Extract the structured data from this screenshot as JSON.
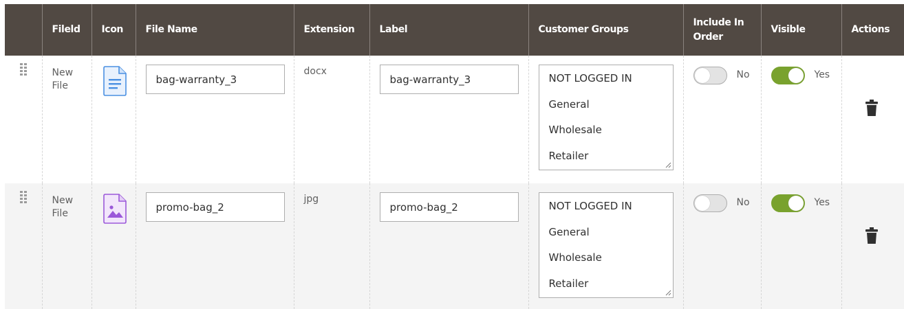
{
  "columns": [
    "Fileld",
    "Icon",
    "File Name",
    "Extension",
    "Label",
    "Customer Groups",
    "Include In Order",
    "Visible",
    "Actions"
  ],
  "rows": [
    {
      "file_id": "New File",
      "icon": "document-icon",
      "icon_color": "#4a90e2",
      "file_name": "bag-warranty_3",
      "extension": "docx",
      "label": "bag-warranty_3",
      "customer_groups": [
        "NOT LOGGED IN",
        "General",
        "Wholesale",
        "Retailer"
      ],
      "include_in_order": false,
      "include_label": "No",
      "visible": true,
      "visible_label": "Yes"
    },
    {
      "file_id": "New File",
      "icon": "image-file-icon",
      "icon_color": "#9b59d9",
      "file_name": "promo-bag_2",
      "extension": "jpg",
      "label": "promo-bag_2",
      "customer_groups": [
        "NOT LOGGED IN",
        "General",
        "Wholesale",
        "Retailer"
      ],
      "include_in_order": false,
      "include_label": "No",
      "visible": true,
      "visible_label": "Yes"
    }
  ],
  "colors": {
    "header_bg": "#514943",
    "toggle_on": "#79a22e",
    "row_alt_bg": "#f4f4f4"
  }
}
